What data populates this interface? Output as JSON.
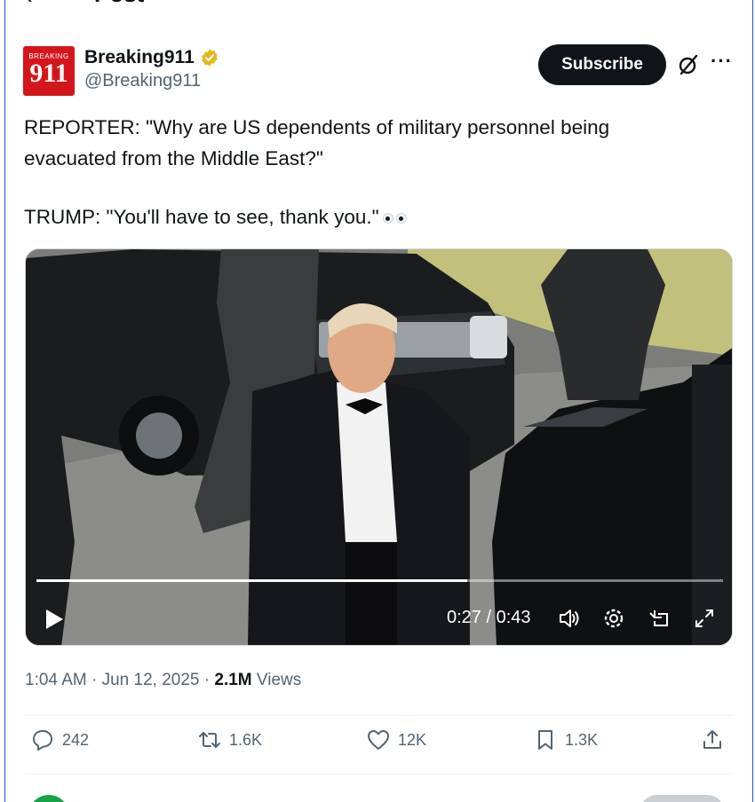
{
  "header": {
    "title": "Post",
    "back_icon": "arrow-left-icon"
  },
  "author": {
    "avatar_text_top": "BREAKING",
    "avatar_text_main": "911",
    "display_name": "Breaking911",
    "handle": "@Breaking911",
    "verified": true,
    "verified_color": "#e2b719"
  },
  "actions_top": {
    "subscribe_label": "Subscribe",
    "grok_icon": "grok-icon",
    "more_label": "···"
  },
  "tweet": {
    "line1": "REPORTER: \"Why are US dependents of military personnel being",
    "line2": "evacuated from the Middle East?\"",
    "line3": "TRUMP: \"You'll have to see, thank you.\"",
    "emoji": "eyes"
  },
  "video": {
    "current_time": "0:27",
    "duration": "0:43",
    "time_readout": "0:27 / 0:43",
    "progress": 0.628
  },
  "meta": {
    "time": "1:04 AM",
    "date": "Jun 12, 2025",
    "views_count": "2.1M",
    "views_label": "Views",
    "separator": "·"
  },
  "engagement": {
    "replies": "242",
    "reposts": "1.6K",
    "likes": "12K",
    "bookmarks": "1.3K"
  },
  "colors": {
    "accent": "#0f1419",
    "muted": "#536471",
    "frame": "#1d4ed8"
  }
}
